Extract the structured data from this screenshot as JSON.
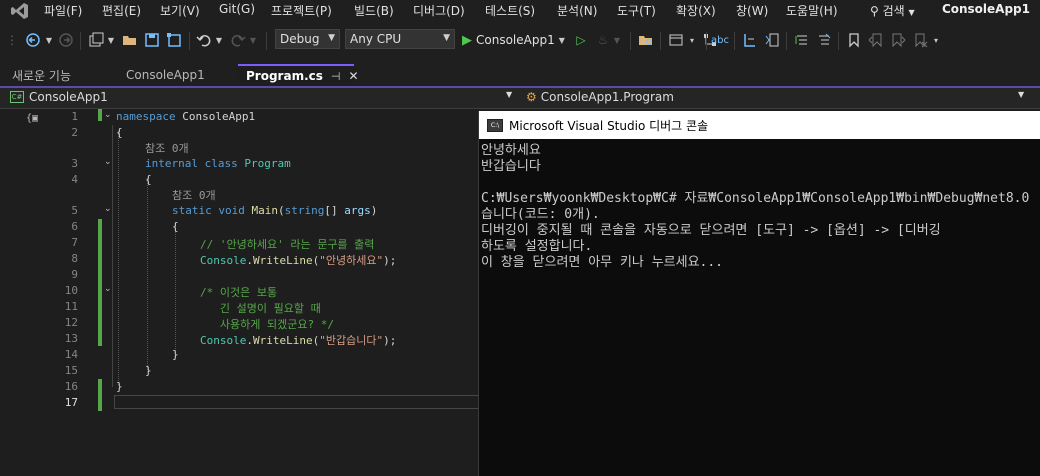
{
  "menu": {
    "items": [
      "파일(F)",
      "편집(E)",
      "보기(V)",
      "Git(G)",
      "프로젝트(P)",
      "빌드(B)",
      "디버그(D)",
      "테스트(S)",
      "분석(N)",
      "도구(T)",
      "확장(X)",
      "창(W)",
      "도움말(H)"
    ],
    "search_label": "검색",
    "app_title": "ConsoleApp1"
  },
  "toolbar": {
    "configuration": "Debug",
    "platform": "Any CPU",
    "run_label": "ConsoleApp1"
  },
  "tabs": [
    {
      "label": "새로운 기능"
    },
    {
      "label": "ConsoleApp1"
    },
    {
      "label": "Program.cs",
      "pin": "⊣",
      "close": "✕"
    }
  ],
  "navbar": {
    "project": "ConsoleApp1",
    "class": "ConsoleApp1.Program"
  },
  "editor": {
    "line_numbers": [
      "1",
      "2",
      "3",
      "4",
      "5",
      "6",
      "7",
      "8",
      "9",
      "10",
      "11",
      "12",
      "13",
      "14",
      "15",
      "16",
      "17"
    ],
    "codelens_1": "참조 0개",
    "codelens_2": "참조 0개",
    "l1_kw": "namespace",
    "l1_name": " ConsoleApp1",
    "l2": "{",
    "l3_kw": "internal class",
    "l3_name": " Program",
    "l4": "{",
    "l5_kw": "static void",
    "l5_fn": " Main",
    "l5_p1": "(",
    "l5_kw2": "string",
    "l5_p2": "[] ",
    "l5_id": "args",
    "l5_p3": ")",
    "l6": "{",
    "l7": "// '안녕하세요' 라는 문구를 출력",
    "l8_ty": "Console",
    "l8_dot": ".",
    "l8_fn": "WriteLine",
    "l8_p1": "(",
    "l8_str": "\"안녕하세요\"",
    "l8_p2": ");",
    "l10": "/* 이것은 보통",
    "l11": "   긴 설명이 필요할 때",
    "l12": "   사용하게 되겠군요? */",
    "l13_ty": "Console",
    "l13_dot": ".",
    "l13_fn": "WriteLine",
    "l13_p1": "(",
    "l13_str": "\"반갑습니다\"",
    "l13_p2": ");",
    "l14": "}",
    "l15": "}",
    "l16": "}"
  },
  "console": {
    "title": "Microsoft Visual Studio 디버그 콘솔",
    "lines": [
      "안녕하세요",
      "반갑습니다",
      "",
      "C:₩Users₩yoonk₩Desktop₩C# 자료₩ConsoleApp1₩ConsoleApp1₩bin₩Debug₩net8.0",
      "습니다(코드: 0개).",
      "디버깅이 중지될 때 콘솔을 자동으로 닫으려면 [도구] -> [옵션] -> [디버깅",
      "하도록 설정합니다.",
      "이 창을 닫으려면 아무 키나 누르세요..."
    ]
  },
  "colors": {
    "accent": "#7c5cff",
    "keyword": "#569cd6",
    "type": "#4ec9b0",
    "string": "#d69d85",
    "comment": "#57a64a"
  }
}
